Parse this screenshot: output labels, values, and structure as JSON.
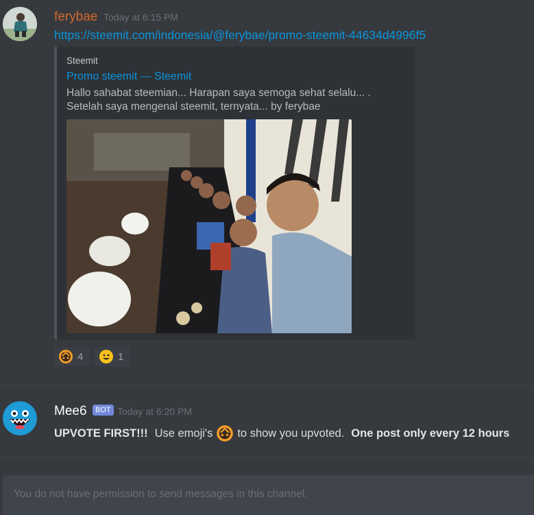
{
  "messages": [
    {
      "username": "ferybae",
      "username_color": "#d2692a",
      "timestamp": "Today at 6:15 PM",
      "link": "https://steemit.com/indonesia/@ferybae/promo-steemit-44634d4996f5",
      "embed": {
        "provider": "Steemit",
        "title": "Promo steemit — Steemit",
        "description_line1": "Hallo sahabat steemian... Harapan saya semoga sehat selalu... .",
        "description_line2": "Setelah saya mengenal steemit, ternyata... by ferybae"
      },
      "reactions": [
        {
          "icon": "steem-upvote-emoji-icon",
          "count": "4"
        },
        {
          "icon": "smiley-emoji-icon",
          "count": "1"
        }
      ]
    },
    {
      "username": "Mee6",
      "username_color": "#ffffff",
      "badge": "BOT",
      "timestamp": "Today at 6:20 PM",
      "text_bold1": "UPVOTE FIRST!!!",
      "text_mid1": "Use emoji's",
      "text_mid2": "to show you upvoted.",
      "text_bold2": "One post only every 12 hours"
    }
  ],
  "input": {
    "placeholder": "You do not have permission to send messages in this channel."
  },
  "colors": {
    "background": "#36393e",
    "link": "#0a96dc",
    "bot_badge": "#7289da"
  }
}
